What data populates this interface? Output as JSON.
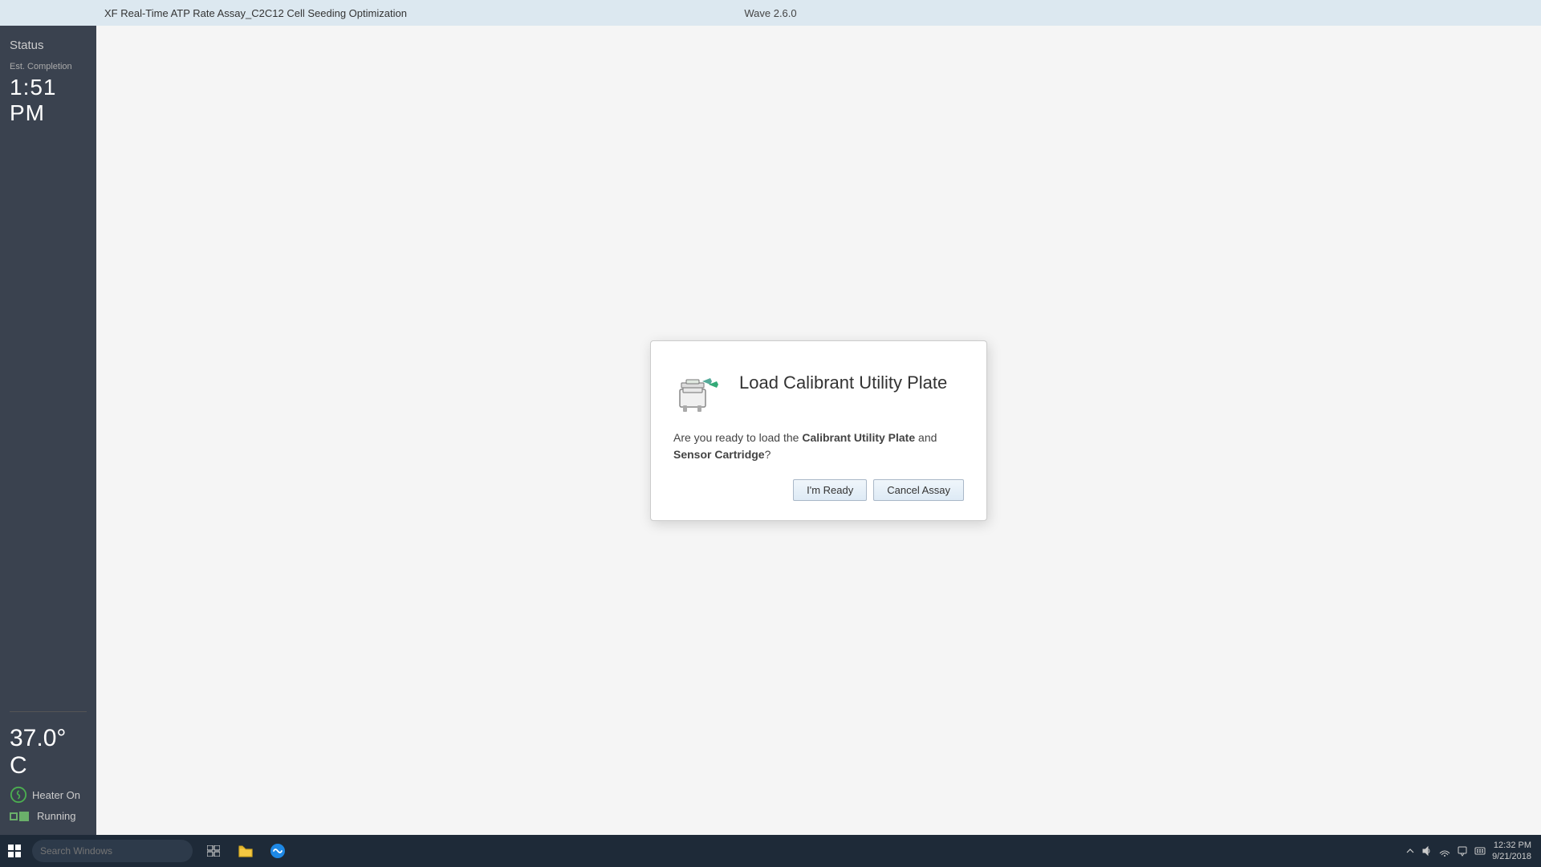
{
  "app": {
    "version": "Wave 2.6.0",
    "window_title": "XF Real-Time ATP Rate Assay_C2C12 Cell Seeding Optimization"
  },
  "sidebar": {
    "status_label": "Status",
    "est_completion_label": "Est. Completion",
    "completion_time": "1:51 PM",
    "temperature": "37.0° C",
    "heater_label": "Heater On",
    "running_label": "Running"
  },
  "dialog": {
    "title": "Load Calibrant Utility Plate",
    "body_text": "Are you ready to load the ",
    "bold1": "Calibrant Utility Plate",
    "middle_text": " and ",
    "bold2": "Sensor Cartridge",
    "end_text": "?",
    "ready_button": "I'm Ready",
    "cancel_button": "Cancel Assay"
  },
  "taskbar": {
    "search_placeholder": "Search Windows",
    "time": "12:32 PM",
    "date": "9/21/2018"
  }
}
